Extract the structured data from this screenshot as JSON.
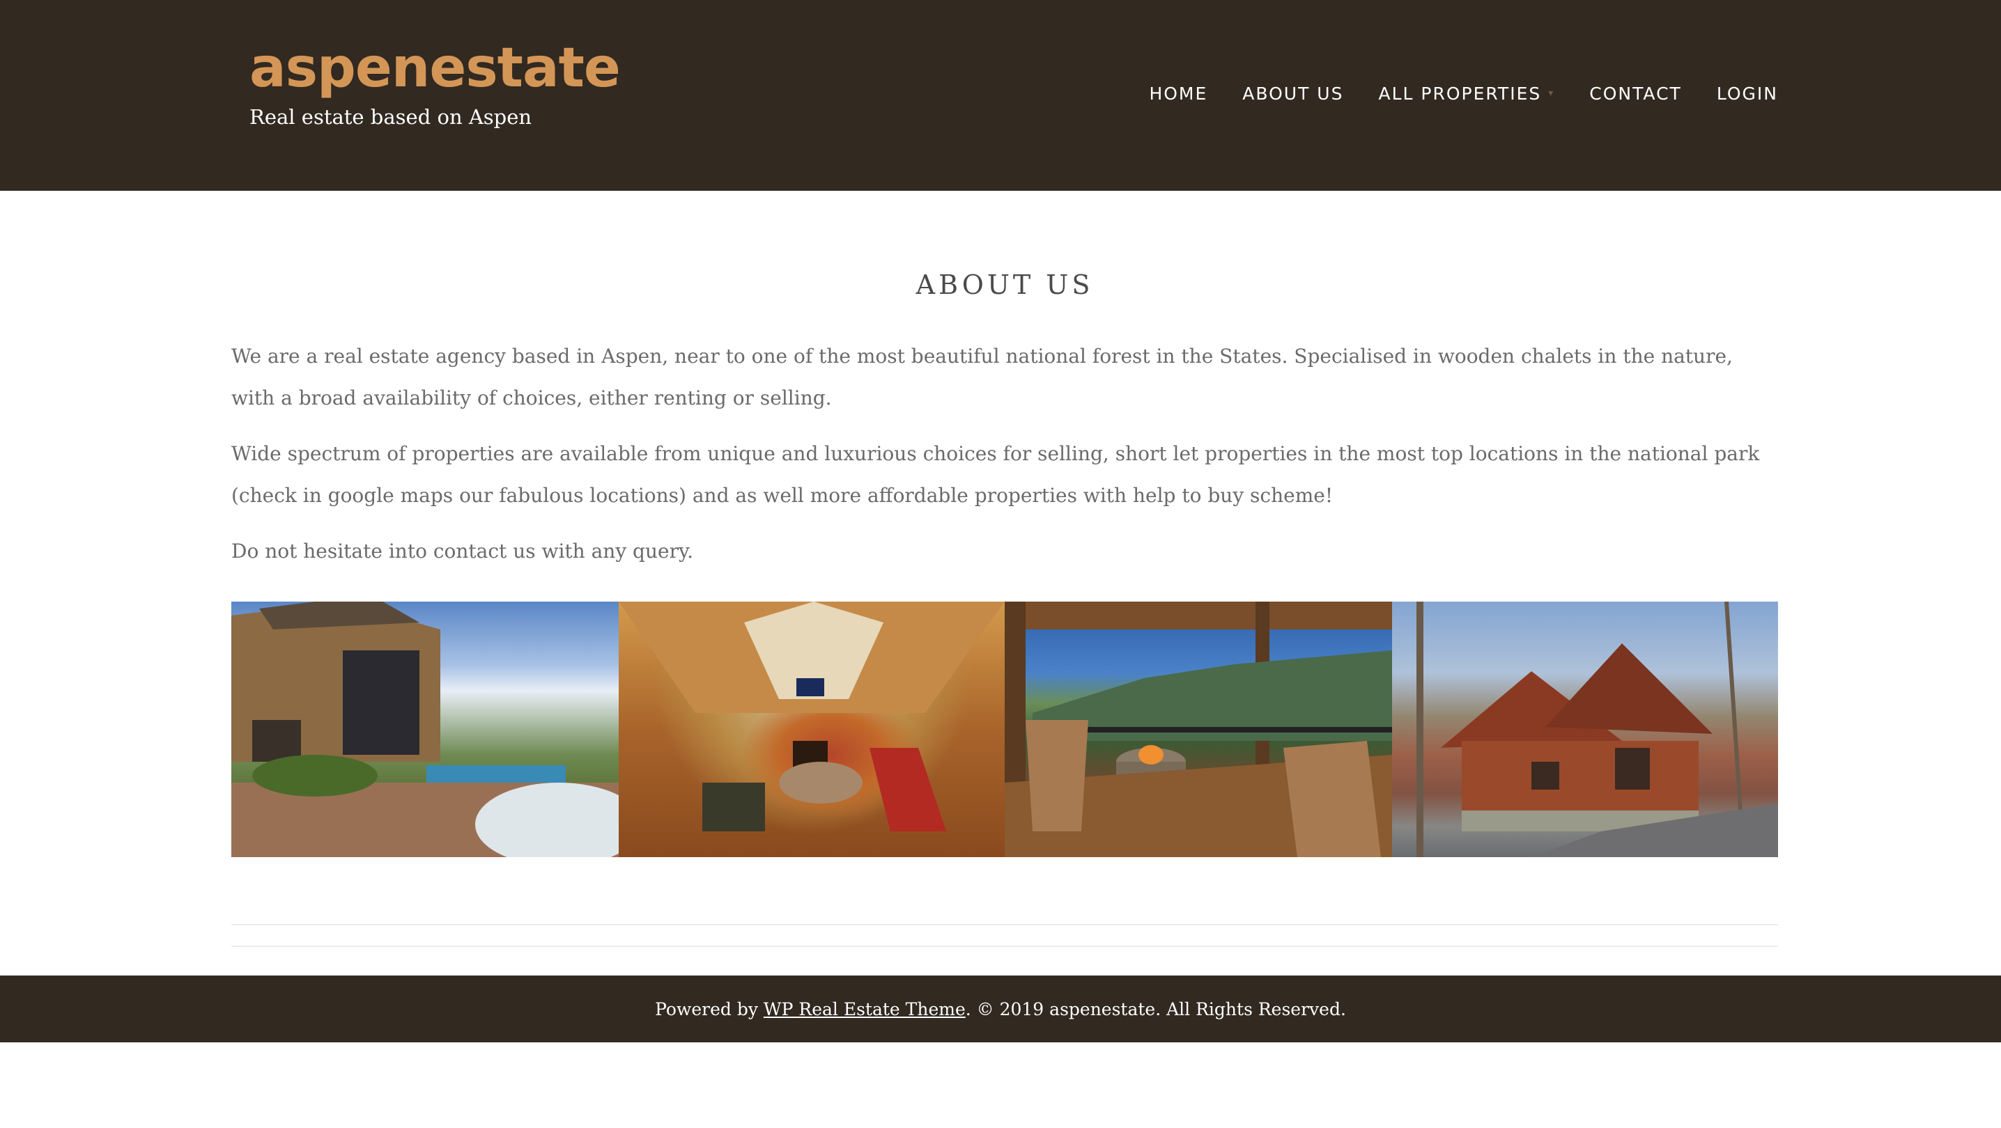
{
  "header": {
    "site_title": "aspenestate",
    "tagline": "Real estate based on Aspen",
    "nav": [
      {
        "label": "HOME"
      },
      {
        "label": "ABOUT US"
      },
      {
        "label": "ALL PROPERTIES",
        "has_dropdown": true
      },
      {
        "label": "CONTACT"
      },
      {
        "label": "LOGIN"
      }
    ]
  },
  "main": {
    "title": "ABOUT US",
    "paragraphs": [
      "We are a real estate agency based in Aspen, near to one of the most beautiful national forest in the States. Specialised in wooden chalets in the nature, with a broad availability of choices, either renting or selling.",
      "Wide spectrum of properties are available from unique and luxurious choices for selling, short let properties in the most top locations in the national park (check in google maps our fabulous locations) and as well more affordable properties with help to buy scheme!",
      "Do not hesitate into contact us with any query."
    ],
    "gallery": [
      {
        "name": "mansion-garden-pool-photo"
      },
      {
        "name": "wooden-living-room-photo"
      },
      {
        "name": "mountain-deck-firepit-photo"
      },
      {
        "name": "red-log-cabin-photo"
      }
    ]
  },
  "footer": {
    "prefix": "Powered by ",
    "link_text": "WP Real Estate Theme",
    "suffix": ". © 2019 aspenestate. All Rights Reserved."
  },
  "colors": {
    "header_bg": "#322921",
    "brand_accent": "#d49656",
    "text_muted": "#6a6a6a"
  }
}
